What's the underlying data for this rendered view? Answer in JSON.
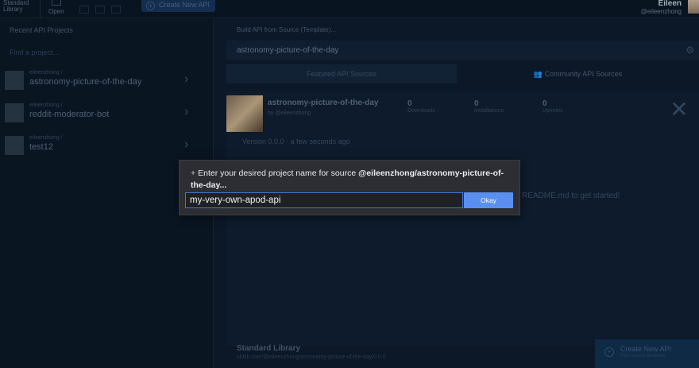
{
  "topbar": {
    "logo_text": "Standard Library",
    "open_label": "Open",
    "create_label": "Create New API",
    "user_name": "Eileen",
    "user_handle": "@eileenzhong"
  },
  "sidebar": {
    "title": "Recent API Projects",
    "search_placeholder": "Find a project...",
    "projects": [
      {
        "owner": "eileenzhong /",
        "name": "astronomy-picture-of-the-day"
      },
      {
        "owner": "eileenzhong /",
        "name": "reddit-moderator-bot"
      },
      {
        "owner": "eileenzhong /",
        "name": "test12"
      }
    ]
  },
  "main": {
    "breadcrumb": "Build API from Source (Template)...",
    "search_value": "astronomy-picture-of-the-day",
    "tabs": [
      {
        "label": "Featured API Sources"
      },
      {
        "label": "Community API Sources"
      }
    ],
    "card": {
      "title": "astronomy-picture-of-the-day",
      "by": "by @eileenzhong",
      "stats": [
        {
          "value": "0",
          "label": "Downloads"
        },
        {
          "value": "0",
          "label": "Installations"
        },
        {
          "value": "0",
          "label": "Upvotes"
        }
      ],
      "version": "Version 0.0.0  ·  a few seconds ago",
      "readme_hint": "README.md to get started!"
    },
    "footer": {
      "title": "Standard Library",
      "subtitle": "stdlib.com/@eileenzhong/astronomy-picture-of-the-day/0.0.0"
    },
    "create_bottom": {
      "label": "Create New API",
      "sublabel": "from source template"
    }
  },
  "modal": {
    "prompt_prefix": "Enter your desired project name for source",
    "source": "@eileenzhong/astronomy-picture-of-the-day...",
    "input_value": "my-very-own-apod-api",
    "ok_label": "Okay"
  },
  "colors": {
    "background": "#0e1c2e",
    "modal_bg": "#2c2e33",
    "ok_button": "#5a8ff0",
    "input_border": "#3d79d8"
  }
}
